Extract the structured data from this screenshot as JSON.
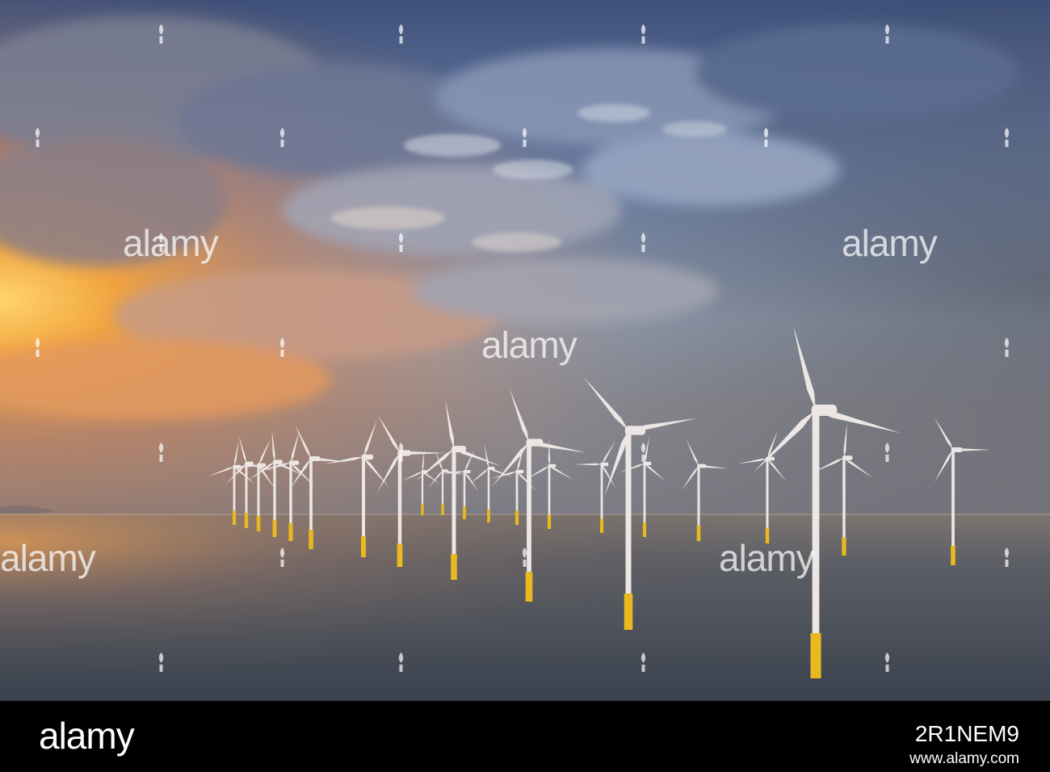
{
  "photo": {
    "subject": "offshore-wind-farm-at-sunset",
    "colors": {
      "sky_top": "#4a5f86",
      "sky_mid": "#8fa2bf",
      "sun_glow": "#f3a13a",
      "sea": "#4c5666",
      "turbine": "#ece6e4",
      "foundation": "#e9b920"
    }
  },
  "watermark": {
    "brand": "alamy"
  },
  "footer": {
    "logo": "alamy",
    "image_id": "2R1NEM9",
    "url": "www.alamy.com"
  }
}
